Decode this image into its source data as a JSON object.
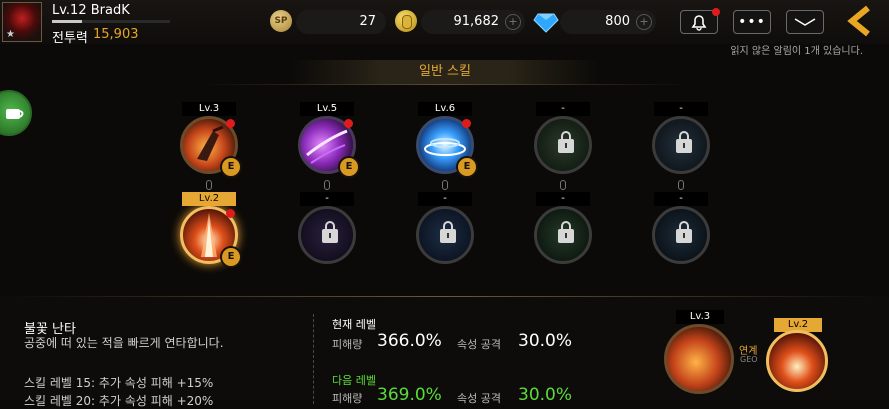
{
  "player": {
    "level_name": "Lv.12 BradK",
    "power_label": "전투력",
    "power_value": "15,903",
    "xp_progress": 0.25
  },
  "currencies": {
    "sp": {
      "icon": "SP",
      "value": "27"
    },
    "gold": {
      "value": "91,682"
    },
    "gem": {
      "value": "800"
    }
  },
  "header_buttons": [
    "bell-icon",
    "chat-icon",
    "mail-icon",
    "back-icon"
  ],
  "notification_tooltip": "읽지 않은 알림이 1개 있습니다.",
  "section_title": "일반 스킬",
  "skills": {
    "row1": [
      {
        "level": "Lv.3",
        "locked": false,
        "badge": "E",
        "new": true
      },
      {
        "level": "Lv.5",
        "locked": false,
        "badge": "E",
        "new": true
      },
      {
        "level": "Lv.6",
        "locked": false,
        "badge": "E",
        "new": true
      },
      {
        "level": "-",
        "locked": true
      },
      {
        "level": "-",
        "locked": true
      }
    ],
    "row2": [
      {
        "level": "Lv.2",
        "locked": false,
        "badge": "E",
        "new": true,
        "selected": true
      },
      {
        "level": "-",
        "locked": true
      },
      {
        "level": "-",
        "locked": true
      },
      {
        "level": "-",
        "locked": true
      },
      {
        "level": "-",
        "locked": true
      }
    ]
  },
  "detail": {
    "name": "불꽃 난타",
    "description": "공중에 떠 있는 적을 빠르게 연타합니다.",
    "extra1": "스킬 레벨 15: 추가 속성 피해 +15%",
    "extra2": "스킬 레벨 20: 추가 속성 피해 +20%",
    "current_label": "현재 레벨",
    "damage_label": "피해량",
    "damage_now": "366.0%",
    "attr_label": "속성 공격",
    "attr_now": "30.0%",
    "next_label": "다음 레벨",
    "damage_next": "369.0%",
    "attr_next": "30.0%"
  },
  "combo": {
    "from_level": "Lv.3",
    "to_level": "Lv.2",
    "label": "연계",
    "sub": "GEO"
  }
}
